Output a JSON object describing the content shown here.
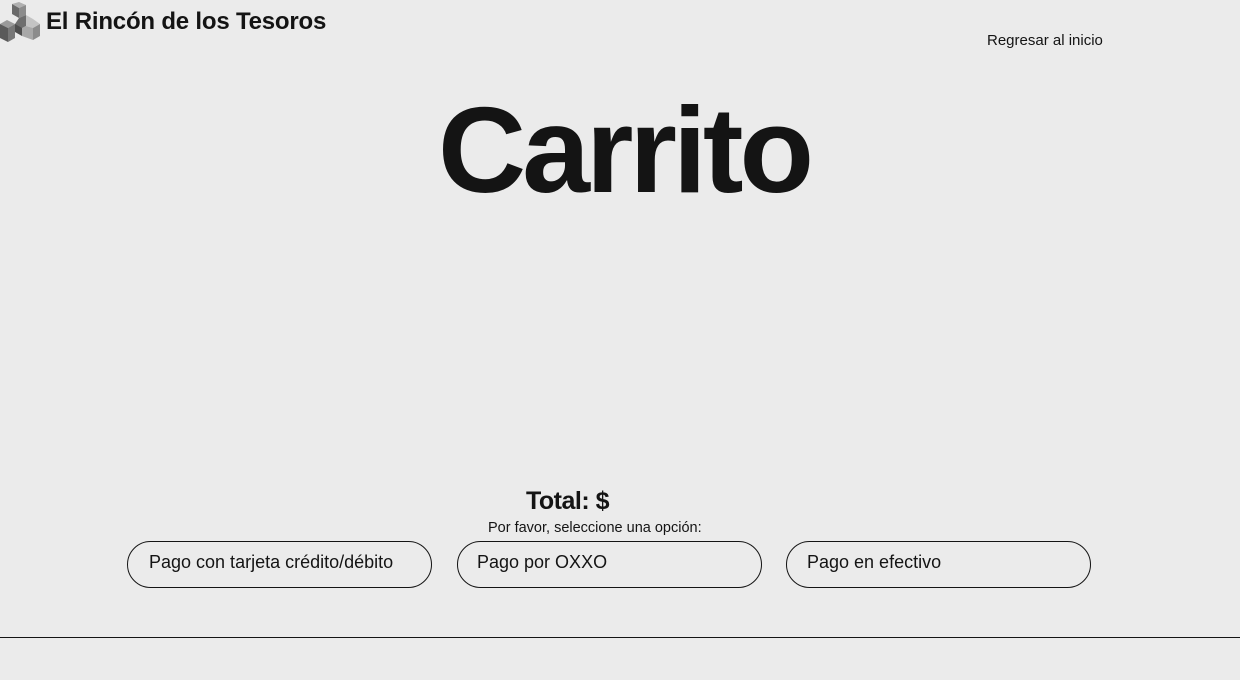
{
  "header": {
    "brand_name": "El Rincón de los Tesoros",
    "logo_icon": "cubes-icon",
    "home_link": "Regresar al inicio"
  },
  "main": {
    "title": "Carrito",
    "total_label": "Total: $",
    "prompt": "Por favor, seleccione una opción:",
    "payment_options": [
      "Pago con tarjeta crédito/débito",
      "Pago por OXXO",
      "Pago en efectivo"
    ]
  },
  "colors": {
    "background": "#ebebeb",
    "text": "#141414",
    "logo_dark": "#5a5a5a",
    "logo_mid": "#8a8a8a",
    "logo_light": "#b8b8b8"
  }
}
